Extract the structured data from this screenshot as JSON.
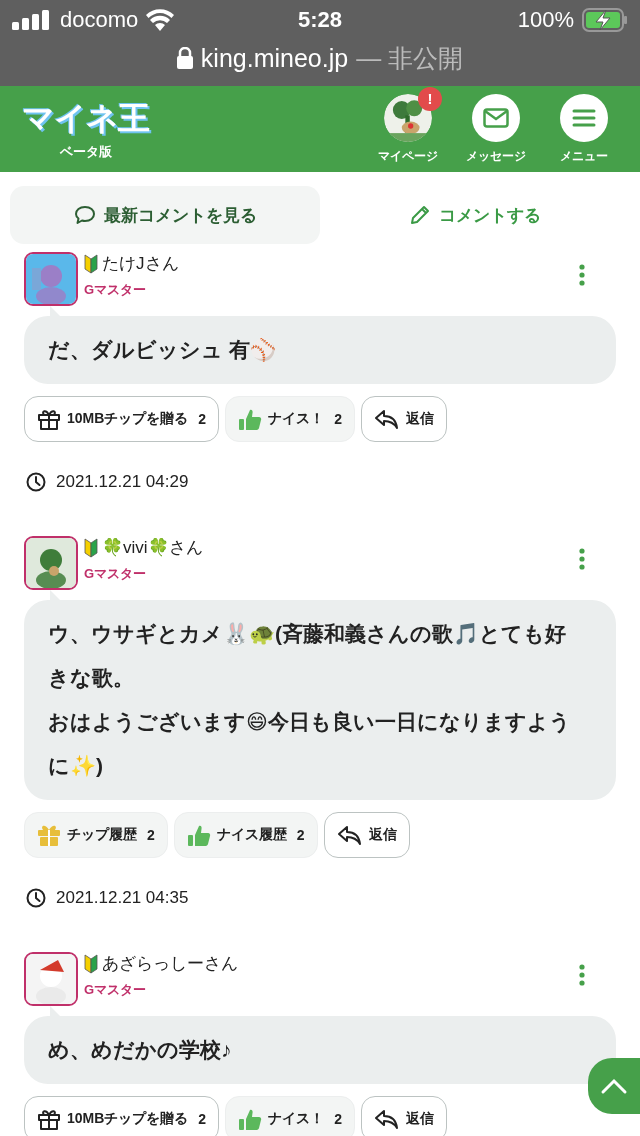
{
  "status_bar": {
    "carrier": "docomo",
    "time": "5:28",
    "battery": "100%",
    "charging": true
  },
  "url_bar": {
    "domain": "king.mineo.jp",
    "suffix": "— 非公開"
  },
  "header": {
    "logo": "マイネ王",
    "logo_sub": "ベータ版",
    "nav": [
      {
        "kind": "avatar",
        "label": "マイページ",
        "badge": "!"
      },
      {
        "kind": "message",
        "label": "メッセージ"
      },
      {
        "kind": "menu",
        "label": "メニュー"
      }
    ]
  },
  "tabs": [
    {
      "kind": "comment-list",
      "label": "最新コメントを見る",
      "selected": true
    },
    {
      "kind": "write",
      "label": "コメントする",
      "selected": false
    }
  ],
  "comments": [
    {
      "user": "たけJさん",
      "beginner": true,
      "rank": "Gマスター",
      "message": [
        "だ、ダルビッシュ 有⚾"
      ],
      "actions": [
        {
          "kind": "tip",
          "label": "10MBチップを贈る",
          "count": "2"
        },
        {
          "kind": "nice",
          "label": "ナイス！",
          "count": "2"
        },
        {
          "kind": "reply",
          "label": "返信"
        }
      ],
      "time": "2021.12.21 04:29"
    },
    {
      "user": "🍀vivi🍀さん",
      "beginner": true,
      "rank": "Gマスター",
      "message": [
        "ウ、ウサギとカメ🐰🐢(斉藤和義さんの歌🎵とても好きな歌。",
        "おはようございます😄今日も良い一日になりますように✨)"
      ],
      "actions": [
        {
          "kind": "tip-history",
          "label": "チップ履歴",
          "count": "2"
        },
        {
          "kind": "nice-history",
          "label": "ナイス履歴",
          "count": "2"
        },
        {
          "kind": "reply",
          "label": "返信"
        }
      ],
      "time": "2021.12.21 04:35"
    },
    {
      "user": "あざらっしーさん",
      "beginner": true,
      "rank": "Gマスター",
      "message": [
        "め、めだかの学校♪"
      ],
      "actions": [
        {
          "kind": "tip",
          "label": "10MBチップを贈る",
          "count": "2"
        },
        {
          "kind": "nice",
          "label": "ナイス！",
          "count": "2"
        },
        {
          "kind": "reply",
          "label": "返信"
        }
      ]
    }
  ]
}
